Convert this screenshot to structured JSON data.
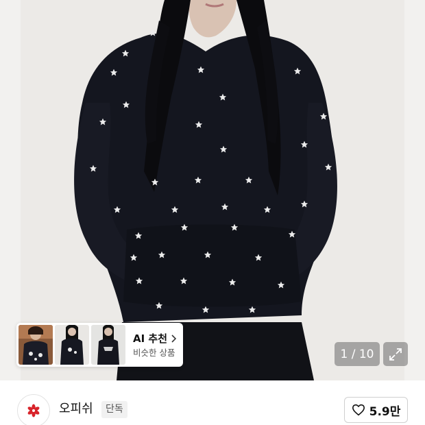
{
  "photo": {
    "counter": "1 / 10"
  },
  "ai_recommend": {
    "title": "AI 추천",
    "subtitle": "비슷한 상품",
    "thumbnails": [
      "similar-item-1",
      "similar-item-2",
      "similar-item-3"
    ]
  },
  "brand": {
    "name": "오피쉬",
    "badge": "단독",
    "like_count": "5.9만"
  },
  "colors": {
    "hoodie": "#14161f",
    "star": "#ececec",
    "backdrop": "#f2f1ef",
    "logo_red": "#d8232a"
  },
  "icons": [
    "chevron-right-icon",
    "expand-icon",
    "heart-icon",
    "brand-logo-icon"
  ]
}
